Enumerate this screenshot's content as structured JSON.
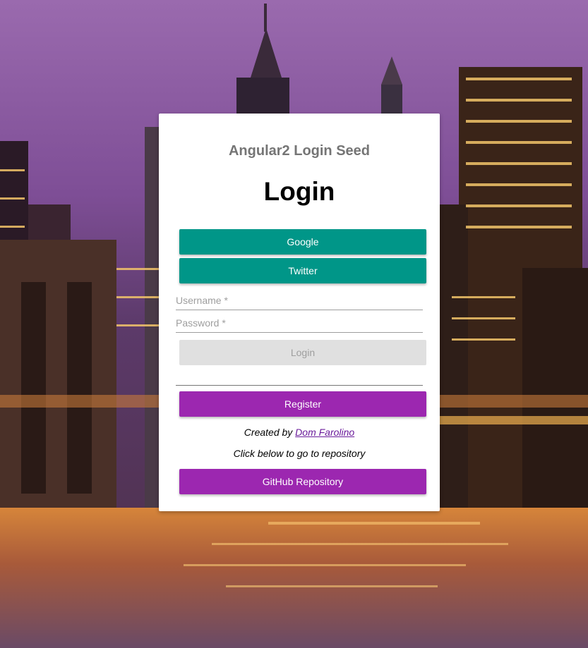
{
  "app_title": "Angular2 Login Seed",
  "heading": "Login",
  "social": {
    "google_label": "Google",
    "twitter_label": "Twitter"
  },
  "form": {
    "username_placeholder": "Username *",
    "password_placeholder": "Password *",
    "login_label": "Login"
  },
  "register_label": "Register",
  "footer": {
    "created_by_prefix": "Created by",
    "author_name": "Dom Farolino",
    "repo_hint": "Click below to go to repository",
    "repo_button_label": "GitHub Repository"
  },
  "colors": {
    "teal": "#009688",
    "purple": "#9c27b0",
    "disabled": "#e0e0e0"
  }
}
